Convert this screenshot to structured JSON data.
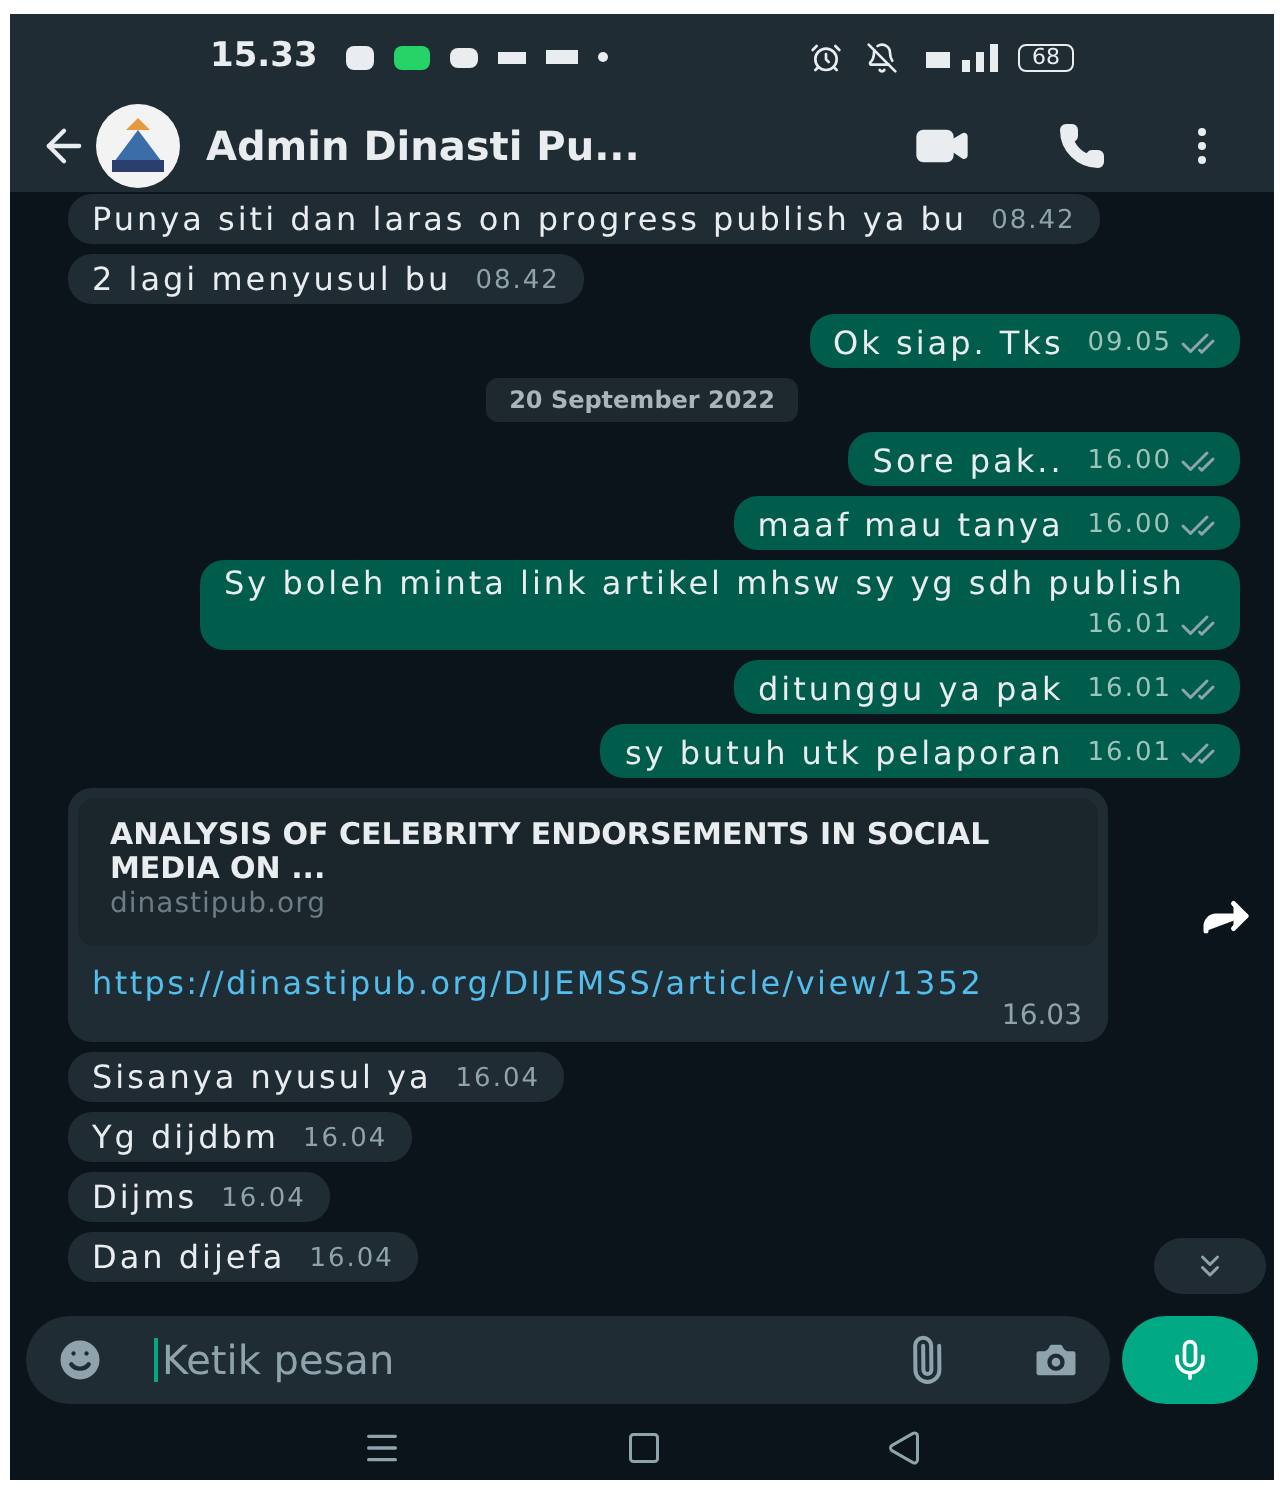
{
  "status_bar": {
    "time": "15.33",
    "battery": "68"
  },
  "header": {
    "title": "Admin Dinasti Pu..."
  },
  "messages": [
    {
      "kind": "incoming",
      "text": "Punya siti dan laras on progress publish ya bu",
      "time": "08.42"
    },
    {
      "kind": "incoming",
      "text": "2 lagi menyusul bu",
      "time": "08.42"
    },
    {
      "kind": "outgoing",
      "text": "Ok siap. Tks",
      "time": "09.05",
      "read": false
    },
    {
      "kind": "date",
      "text": "20 September 2022"
    },
    {
      "kind": "outgoing",
      "text": "Sore pak..",
      "time": "16.00",
      "read": false
    },
    {
      "kind": "outgoing",
      "text": "maaf mau tanya",
      "time": "16.00",
      "read": false
    },
    {
      "kind": "outgoing",
      "text": "Sy boleh minta link artikel mhsw sy yg sdh publish",
      "time": "16.01",
      "read": false
    },
    {
      "kind": "outgoing",
      "text": "ditunggu ya pak",
      "time": "16.01",
      "read": false
    },
    {
      "kind": "outgoing",
      "text": "sy butuh utk pelaporan",
      "time": "16.01",
      "read": false
    },
    {
      "kind": "link",
      "preview_title": "ANALYSIS OF CELEBRITY ENDORSEMENTS IN SOCIAL MEDIA ON ...",
      "preview_domain": "dinastipub.org",
      "text": "https://dinastipub.org/DIJEMSS/article/view/1352",
      "time": "16.03"
    },
    {
      "kind": "incoming",
      "text": "Sisanya nyusul ya",
      "time": "16.04"
    },
    {
      "kind": "incoming",
      "text": "Yg dijdbm",
      "time": "16.04"
    },
    {
      "kind": "incoming",
      "text": "Dijms",
      "time": "16.04"
    },
    {
      "kind": "incoming",
      "text": "Dan dijefa",
      "time": "16.04"
    }
  ],
  "composer": {
    "placeholder": "Ketik pesan"
  }
}
